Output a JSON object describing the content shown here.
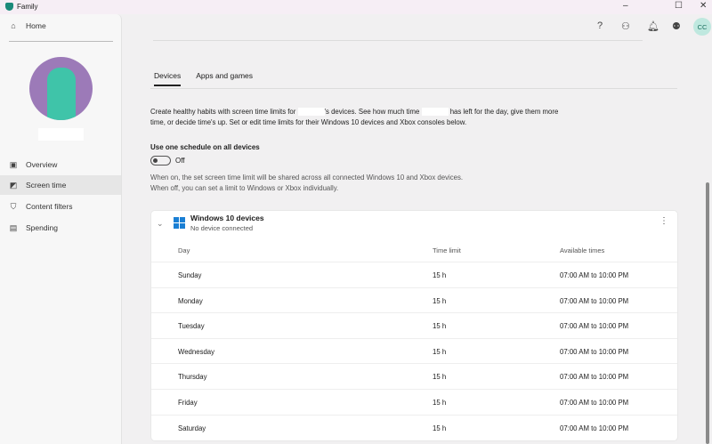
{
  "app": {
    "title": "Family"
  },
  "sidebar": {
    "home": "Home",
    "items": [
      {
        "label": "Overview",
        "icon": "overview-icon"
      },
      {
        "label": "Screen time",
        "icon": "screen-time-icon"
      },
      {
        "label": "Content filters",
        "icon": "shield-icon"
      },
      {
        "label": "Spending",
        "icon": "spending-icon"
      }
    ]
  },
  "header": {
    "avatar_initials": "CC"
  },
  "tabs": [
    {
      "label": "Devices"
    },
    {
      "label": "Apps and games"
    }
  ],
  "description": {
    "part1": "Create healthy habits with screen time limits for",
    "part2": "'s devices. See how much time",
    "part3": "has left for the day, give them more time, or decide time's up. Set or edit time limits for their Windows 10 devices and Xbox consoles below."
  },
  "schedule": {
    "label": "Use one schedule on all devices",
    "toggle_state": "Off",
    "note1": "When on, the set screen time limit will be shared across all connected Windows 10 and Xbox devices.",
    "note2": "When off, you can set a limit to Windows or Xbox individually."
  },
  "device": {
    "title": "Windows 10 devices",
    "status": "No device connected",
    "columns": [
      "Day",
      "Time limit",
      "Available times"
    ],
    "rows": [
      [
        "Sunday",
        "15 h",
        "07:00 AM to 10:00 PM"
      ],
      [
        "Monday",
        "15 h",
        "07:00 AM to 10:00 PM"
      ],
      [
        "Tuesday",
        "15 h",
        "07:00 AM to 10:00 PM"
      ],
      [
        "Wednesday",
        "15 h",
        "07:00 AM to 10:00 PM"
      ],
      [
        "Thursday",
        "15 h",
        "07:00 AM to 10:00 PM"
      ],
      [
        "Friday",
        "15 h",
        "07:00 AM to 10:00 PM"
      ],
      [
        "Saturday",
        "15 h",
        "07:00 AM to 10:00 PM"
      ]
    ]
  }
}
